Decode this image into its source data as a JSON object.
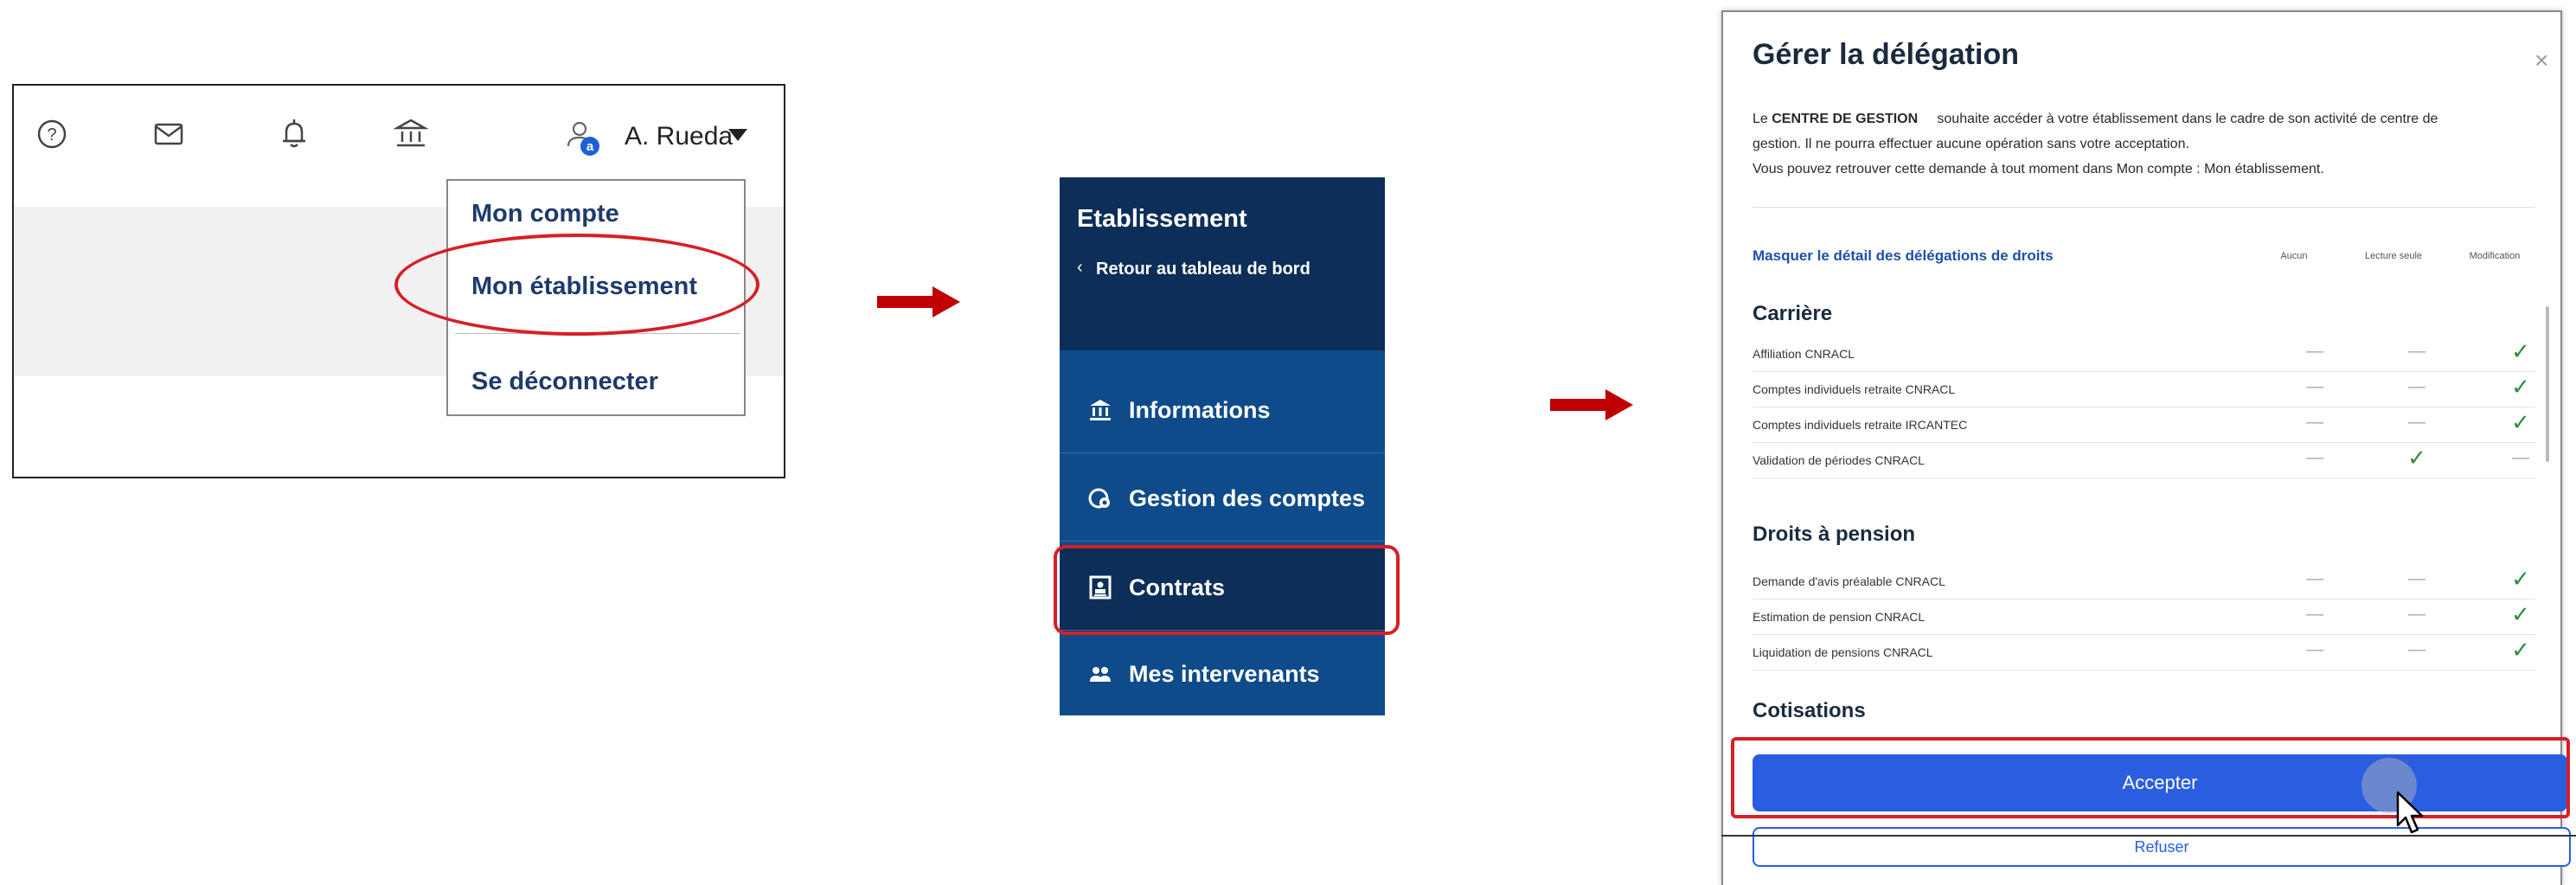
{
  "panel1": {
    "user_name": "A. Rueda",
    "menu_items": [
      "Mon compte",
      "Mon établissement",
      "Se déconnecter"
    ]
  },
  "panel2": {
    "title": "Etablissement",
    "back_label": "Retour au tableau de bord",
    "items": [
      "Informations",
      "Gestion des comptes",
      "Contrats",
      "Mes intervenants"
    ]
  },
  "panel3": {
    "title": "Gérer la délégation",
    "close": "×",
    "intro_org": "CENTRE DE GESTION",
    "intro_line1_prefix": "Le ",
    "intro_line1_suffix": "souhaite accéder à votre établissement dans le cadre de son activité de centre de",
    "intro_line2": "gestion. Il ne pourra effectuer aucune opération sans votre acceptation.",
    "intro_line3": "Vous pouvez retrouver cette demande à tout moment dans Mon compte : Mon établissement.",
    "hide_link": "Masquer le détail des délégations de droits",
    "col_headers": [
      "Aucun",
      "Lecture seule",
      "Modification"
    ],
    "sections": [
      {
        "name": "Carrière",
        "rows": [
          {
            "label": "Affiliation CNRACL",
            "aucun": "—",
            "lecture": "—",
            "modif": "✓"
          },
          {
            "label": "Comptes individuels retraite CNRACL",
            "aucun": "—",
            "lecture": "—",
            "modif": "✓"
          },
          {
            "label": "Comptes individuels retraite IRCANTEC",
            "aucun": "—",
            "lecture": "—",
            "modif": "✓"
          },
          {
            "label": "Validation de périodes CNRACL",
            "aucun": "—",
            "lecture": "✓",
            "modif": "—"
          }
        ]
      },
      {
        "name": "Droits à pension",
        "rows": [
          {
            "label": "Demande d'avis préalable CNRACL",
            "aucun": "—",
            "lecture": "—",
            "modif": "✓"
          },
          {
            "label": "Estimation de pension CNRACL",
            "aucun": "—",
            "lecture": "—",
            "modif": "✓"
          },
          {
            "label": "Liquidation de pensions CNRACL",
            "aucun": "—",
            "lecture": "—",
            "modif": "✓"
          }
        ]
      },
      {
        "name": "Cotisations",
        "rows": []
      }
    ],
    "accept_label": "Accepter",
    "refuse_label": "Refuser"
  },
  "colors": {
    "highlight_red": "#d61f26",
    "nav_dark": "#0c2e58",
    "nav_blue": "#0f4b8a",
    "primary_blue": "#2a5de0",
    "arrow": "#c00000"
  }
}
